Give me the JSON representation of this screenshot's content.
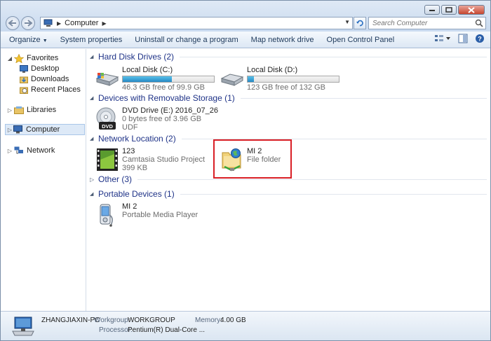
{
  "address": {
    "path": "Computer"
  },
  "search": {
    "placeholder": "Search Computer"
  },
  "toolbar": {
    "organize": "Organize",
    "system_properties": "System properties",
    "uninstall": "Uninstall or change a program",
    "map_network": "Map network drive",
    "open_control_panel": "Open Control Panel"
  },
  "nav": {
    "favorites": "Favorites",
    "desktop": "Desktop",
    "downloads": "Downloads",
    "recent_places": "Recent Places",
    "libraries": "Libraries",
    "computer": "Computer",
    "network": "Network"
  },
  "groups": {
    "hdd": "Hard Disk Drives (2)",
    "removable": "Devices with Removable Storage (1)",
    "network_loc": "Network Location (2)",
    "other": "Other (3)",
    "portable": "Portable Devices (1)"
  },
  "items": {
    "disk_c": {
      "name": "Local Disk (C:)",
      "sub": "46.3 GB free of 99.9 GB",
      "used_fraction": 0.54
    },
    "disk_d": {
      "name": "Local Disk (D:)",
      "sub": "123 GB free of 132 GB",
      "used_fraction": 0.07
    },
    "dvd": {
      "name": "DVD Drive (E:) 2016_07_26",
      "sub1": "0 bytes free of 3.96 GB",
      "sub2": "UDF",
      "badge": "DVD"
    },
    "camtasia": {
      "name": "123",
      "sub1": "Camtasia Studio Project",
      "sub2": "399 KB"
    },
    "mi2_folder": {
      "name": "MI 2",
      "sub": "File folder"
    },
    "mi2_player": {
      "name": "MI 2",
      "sub": "Portable Media Player"
    }
  },
  "details": {
    "pc_name": "ZHANGJIAXIN-PC",
    "workgroup_label": "Workgroup:",
    "workgroup_value": "WORKGROUP",
    "memory_label": "Memory:",
    "memory_value": "4.00 GB",
    "processor_label": "Processor:",
    "processor_value": "Pentium(R) Dual-Core ..."
  },
  "colors": {
    "accent_highlight": "#d91f26",
    "group_title": "#1e3287",
    "disk_bar": "#2789c4"
  }
}
